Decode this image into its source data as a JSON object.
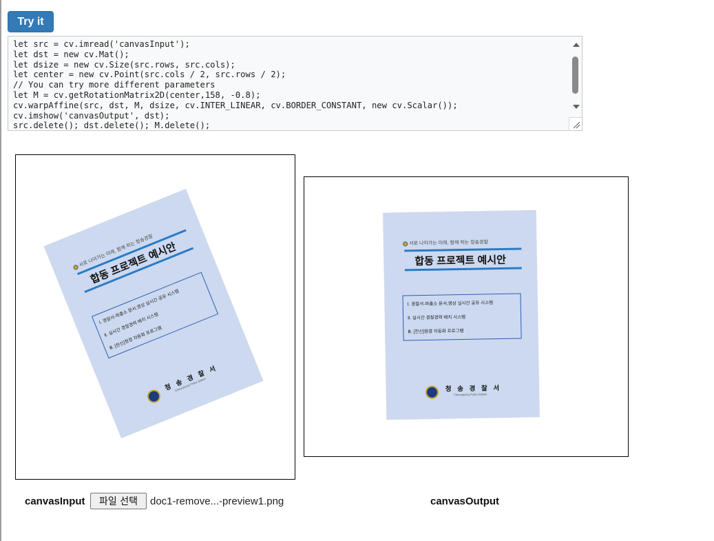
{
  "toolbar": {
    "try_label": "Try it"
  },
  "code": {
    "lines": [
      "let src = cv.imread('canvasInput');",
      "let dst = new cv.Mat();",
      "let dsize = new cv.Size(src.rows, src.cols);",
      "let center = new cv.Point(src.cols / 2, src.rows / 2);",
      "// You can try more different parameters",
      "let M = cv.getRotationMatrix2D(center,158, -0.8);",
      "cv.warpAffine(src, dst, M, dsize, cv.INTER_LINEAR, cv.BORDER_CONSTANT, new cv.Scalar());",
      "cv.imshow('canvasOutput', dst);",
      "src.delete(); dst.delete(); M.delete();"
    ]
  },
  "document": {
    "header_small": "서로 나아가는 미래, 함께 하는 청송경찰",
    "title": "합동 프로젝트 예시안",
    "items": [
      "Ⅰ. 경찰서-파출소 문서,영상 실시간 공유 시스템",
      "Ⅱ. 실시간 경찰경력 배치 시스템",
      "Ⅲ. [천신]청경 자동화 프로그램"
    ],
    "org": "청 송 경 찰 서",
    "org_sub": "Cheongsong Police Station",
    "paper_color": "#ccd9f0"
  },
  "input_panel": {
    "label": "canvasInput",
    "file_button": "파일 선택",
    "file_name": "doc1-remove...-preview1.png"
  },
  "output_panel": {
    "label": "canvasOutput"
  },
  "colors": {
    "button": "#337ab7",
    "stripe": "#2a7bc4"
  }
}
